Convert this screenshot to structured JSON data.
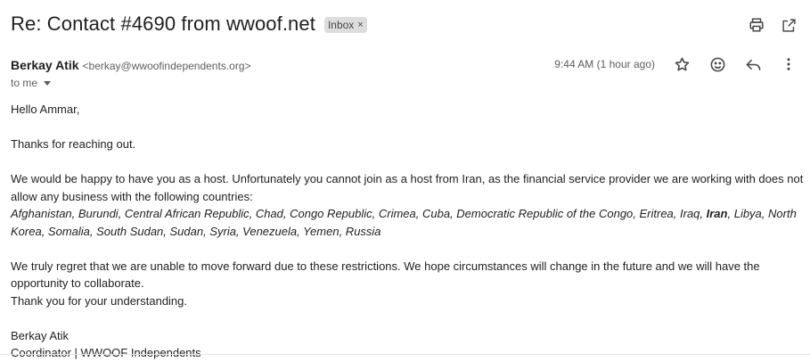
{
  "subject": "Re: Contact #4690 from wwoof.net",
  "label_chip": {
    "text": "Inbox",
    "remove_glyph": "×"
  },
  "toolbar_icons": [
    "print-icon",
    "open-in-new-window-icon"
  ],
  "sender": {
    "name": "Berkay Atik",
    "email": "<berkay@wwoofindependents.org>",
    "to_text": "to me"
  },
  "timestamp": "9:44 AM (1 hour ago)",
  "message_icons": [
    "star-icon",
    "emoji-reaction-icon",
    "reply-icon",
    "more-vert-icon"
  ],
  "body": {
    "greeting": "Hello Ammar,",
    "line1": "Thanks for reaching out.",
    "para1": "We would be happy to have you as a host. Unfortunately you cannot join as a host from Iran, as the financial service provider we are working with does not allow any business with the following countries:",
    "countries_before": "Afghanistan, Burundi, Central African Republic, Chad, Congo Republic, Crimea, Cuba, Democratic Republic of the Congo, Eritrea, Iraq, ",
    "countries_bold": "Iran",
    "countries_after": ", Libya, North Korea, Somalia, South Sudan, Sudan, Syria, Venezuela, Yemen, Russia",
    "para2": "We truly regret that we are unable to move forward due to these restrictions. We hope circumstances will change in the future and we will have the opportunity to collaborate.",
    "thanks": "Thank you for your understanding.",
    "signature_name": "Berkay Atik",
    "signature_title": "Coordinator | WWOOF Independents"
  },
  "colors": {
    "text": "#222222",
    "muted": "#5e5e5e",
    "chip_bg": "#dddddd",
    "icon": "#444746"
  }
}
